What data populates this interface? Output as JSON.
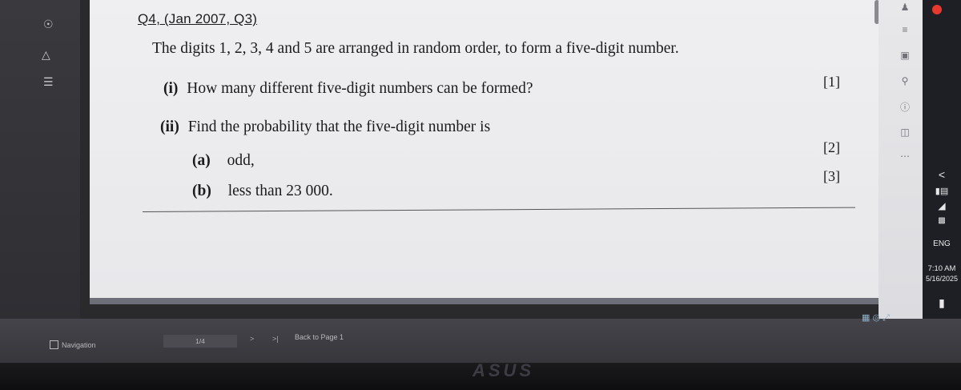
{
  "document": {
    "question_header": "Q4, (Jan 2007, Q3)",
    "intro": "The digits 1, 2, 3, 4 and 5 are arranged in random order, to form a five-digit number.",
    "part_i_label": "(i)",
    "part_i_text": "How many different five-digit numbers can be formed?",
    "part_i_mark": "[1]",
    "part_ii_label": "(ii)",
    "part_ii_text": "Find the probability that the five-digit number is",
    "part_a_label": "(a)",
    "part_a_text": "odd,",
    "part_a_mark": "[2]",
    "part_b_label": "(b)",
    "part_b_text": "less than 23 000.",
    "part_b_mark": "[3]"
  },
  "status_bar": {
    "navigation_label": "Navigation",
    "page_indicator": "1/4",
    "next_symbol": ">",
    "last_symbol": ">|",
    "back_to_page": "Back to Page 1"
  },
  "taskbar": {
    "language": "ENG",
    "time": "7:10 AM",
    "date": "5/16/2025",
    "collapse_symbol": "<"
  },
  "icons": {
    "left": [
      "pin-icon",
      "shapes-icon",
      "layers-icon"
    ],
    "right_toolbar": [
      "person-icon",
      "translate-icon",
      "doc-icon",
      "search-icon",
      "help-icon",
      "split-icon",
      "more-icon"
    ],
    "taskbar": [
      "battery-icon",
      "volume-icon",
      "network-icon",
      "keyboard-icon",
      "notification-icon"
    ]
  },
  "brand": "ASUS",
  "colors": {
    "page_bg": "#efeff1",
    "text": "#1b1b1d",
    "record_dot": "#e8392e",
    "taskbar_bg": "#1d1f24"
  }
}
